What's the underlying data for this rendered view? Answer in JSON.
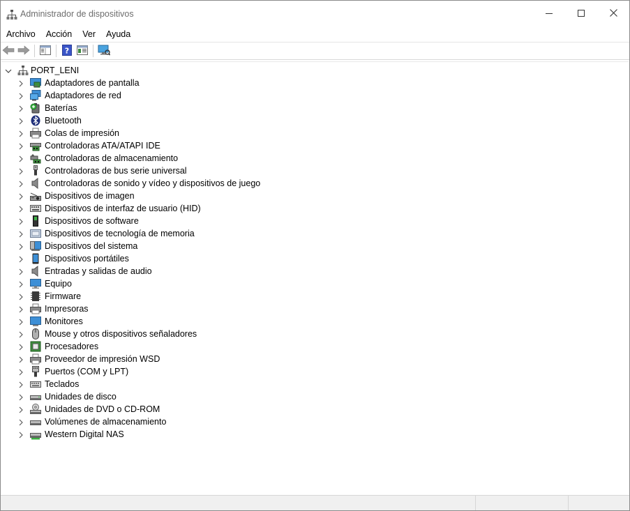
{
  "window": {
    "title": "Administrador de dispositivos",
    "app_icon": "device-manager-icon",
    "controls": [
      "minimize-icon",
      "maximize-icon",
      "close-icon"
    ]
  },
  "menubar": [
    {
      "label": "Archivo"
    },
    {
      "label": "Acción"
    },
    {
      "label": "Ver"
    },
    {
      "label": "Ayuda"
    }
  ],
  "toolbar": [
    {
      "icon": "back-arrow-icon"
    },
    {
      "icon": "forward-arrow-icon"
    },
    {
      "icon": "properties-panel-icon"
    },
    {
      "icon": "help-icon"
    },
    {
      "icon": "show-hide-console-icon"
    },
    {
      "icon": "scan-hardware-monitor-icon"
    }
  ],
  "tree": {
    "root": {
      "label": "PORT_LENI",
      "icon": "computer-network-icon"
    },
    "items": [
      {
        "label": "Adaptadores de pantalla",
        "icon": "display-adapter-icon"
      },
      {
        "label": "Adaptadores de red",
        "icon": "network-adapter-icon"
      },
      {
        "label": "Baterías",
        "icon": "battery-icon"
      },
      {
        "label": "Bluetooth",
        "icon": "bluetooth-icon"
      },
      {
        "label": "Colas de impresión",
        "icon": "print-queue-icon"
      },
      {
        "label": "Controladoras ATA/ATAPI IDE",
        "icon": "ide-controller-icon"
      },
      {
        "label": "Controladoras de almacenamiento",
        "icon": "storage-controller-icon"
      },
      {
        "label": "Controladoras de bus serie universal",
        "icon": "usb-icon"
      },
      {
        "label": "Controladoras de sonido y vídeo y dispositivos de juego",
        "icon": "speaker-icon"
      },
      {
        "label": "Dispositivos de imagen",
        "icon": "camera-icon"
      },
      {
        "label": "Dispositivos de interfaz de usuario (HID)",
        "icon": "hid-icon"
      },
      {
        "label": "Dispositivos de software",
        "icon": "software-device-icon"
      },
      {
        "label": "Dispositivos de tecnología de memoria",
        "icon": "memory-device-icon"
      },
      {
        "label": "Dispositivos del sistema",
        "icon": "system-device-icon"
      },
      {
        "label": "Dispositivos portátiles",
        "icon": "portable-device-icon"
      },
      {
        "label": "Entradas y salidas de audio",
        "icon": "audio-io-icon"
      },
      {
        "label": "Equipo",
        "icon": "computer-icon"
      },
      {
        "label": "Firmware",
        "icon": "firmware-chip-icon"
      },
      {
        "label": "Impresoras",
        "icon": "printer-icon"
      },
      {
        "label": "Monitores",
        "icon": "monitor-icon"
      },
      {
        "label": "Mouse y otros dispositivos señaladores",
        "icon": "mouse-icon"
      },
      {
        "label": "Procesadores",
        "icon": "processor-icon"
      },
      {
        "label": "Proveedor de impresión WSD",
        "icon": "wsd-printer-icon"
      },
      {
        "label": "Puertos (COM y LPT)",
        "icon": "port-icon"
      },
      {
        "label": "Teclados",
        "icon": "keyboard-icon"
      },
      {
        "label": "Unidades de disco",
        "icon": "disk-drive-icon"
      },
      {
        "label": "Unidades de DVD o CD-ROM",
        "icon": "dvd-drive-icon"
      },
      {
        "label": "Volúmenes de almacenamiento",
        "icon": "storage-volume-icon"
      },
      {
        "label": "Western Digital NAS",
        "icon": "nas-drive-icon"
      }
    ]
  }
}
